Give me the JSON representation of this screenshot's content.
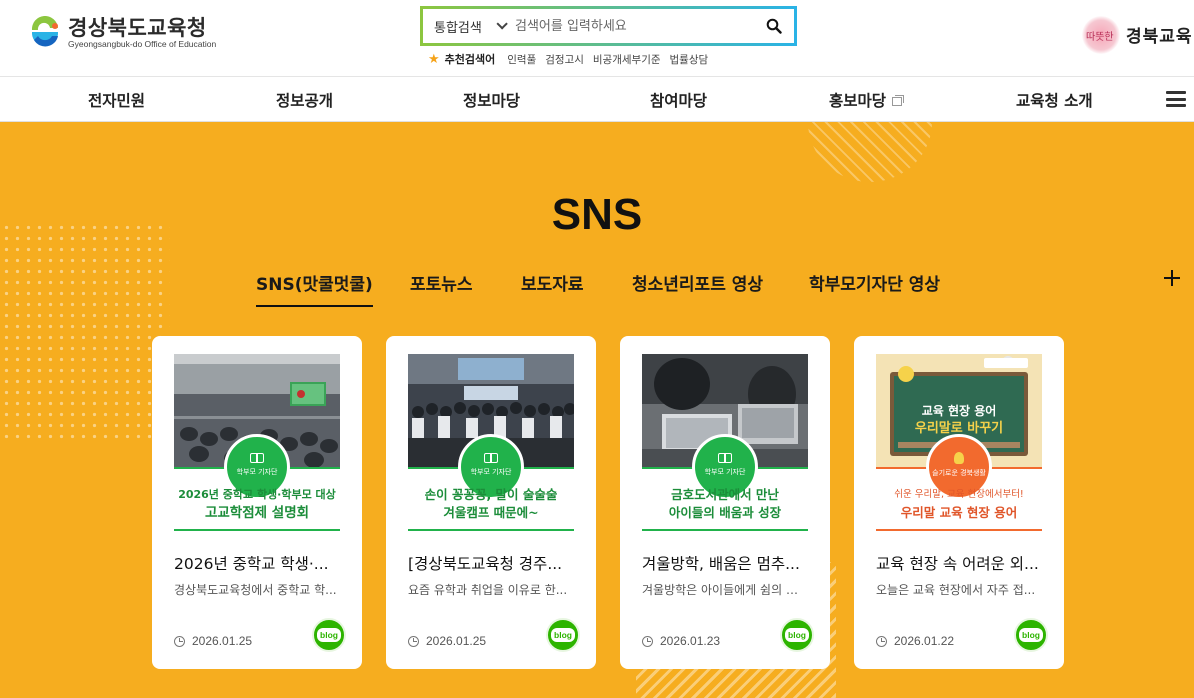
{
  "header": {
    "logo_title": "경상북도교육청",
    "logo_subtitle": "Gyeongsangbuk-do Office of Education",
    "search": {
      "scope": "통합검색",
      "placeholder": "검색어를 입력하세요"
    },
    "recommended": {
      "label": "추천검색어",
      "items": [
        "인력풀",
        "검정고시",
        "비공개세부기준",
        "법률상담"
      ]
    },
    "brand": {
      "small": "따뜻한",
      "big": "경북교육"
    }
  },
  "nav": {
    "items": [
      "전자민원",
      "정보공개",
      "정보마당",
      "참여마당",
      "홍보마당",
      "교육청 소개"
    ]
  },
  "main": {
    "section_title": "SNS",
    "tabs": [
      "SNS(맛쿨멋쿨)",
      "포토뉴스",
      "보도자료",
      "청소년리포트 영상",
      "학부모기자단 영상"
    ],
    "active_tab": "SNS(맛쿨멋쿨)",
    "cards": [
      {
        "badge": "학부모 기자단",
        "caption_line1": "2026년 중학교 학생·학부모 대상",
        "caption_line2": "고교학점제 설명회",
        "title": "2026년 중학교 학생·...",
        "desc": "경상북도교육청에서 중학교 학...",
        "date": "2026.01.25",
        "source": "blog"
      },
      {
        "badge": "학부모 기자단",
        "caption_line1": "손이 꽁꽁꽁, 말이 술술술",
        "caption_line2": "겨울캠프 때문에~",
        "title": "[경상북도교육청 경주...",
        "desc": "요즘 유학과 취업을 이유로 한...",
        "date": "2026.01.25",
        "source": "blog"
      },
      {
        "badge": "학부모 기자단",
        "caption_line1": "금호도서관에서 만난",
        "caption_line2": "아이들의 배움과 성장",
        "title": "겨울방학, 배움은 멈추...",
        "desc": "겨울방학은 아이들에게 쉼의 시...",
        "date": "2026.01.23",
        "source": "blog"
      },
      {
        "badge": "슬기로운 경북생활",
        "board_line1": "교육 현장 용어",
        "board_line2": "우리말로 바꾸기",
        "caption_line1": "쉬운 우리말, 교육 현장에서부터!",
        "caption_line2": "우리말 교육 현장 용어",
        "title": "교육 현장 속 어려운 외...",
        "desc": "오늘은 교육 현장에서 자주 접...",
        "date": "2026.01.22",
        "source": "blog"
      }
    ]
  },
  "colors": {
    "main_bg": "#f6ad1f",
    "green": "#21b24b",
    "blog_green": "#2db400",
    "orange": "#f26a2e"
  }
}
